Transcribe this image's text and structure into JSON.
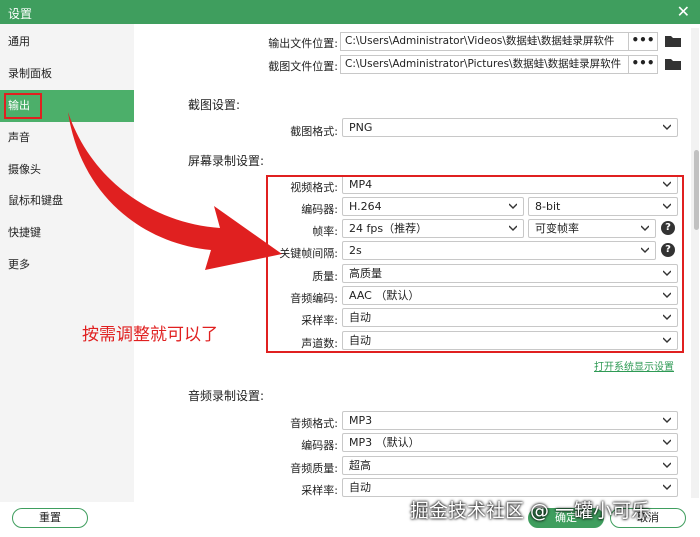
{
  "window": {
    "title": "设置"
  },
  "sidebar": {
    "items": [
      {
        "label": "通用"
      },
      {
        "label": "录制面板"
      },
      {
        "label": "输出"
      },
      {
        "label": "声音"
      },
      {
        "label": "摄像头"
      },
      {
        "label": "鼠标和键盘"
      },
      {
        "label": "快捷键"
      },
      {
        "label": "更多"
      }
    ],
    "active_index": 2
  },
  "output": {
    "output_location_label": "输出文件位置:",
    "output_location_value": "C:\\Users\\Administrator\\Videos\\数据蛙\\数据蛙录屏软件",
    "screenshot_location_label": "截图文件位置:",
    "screenshot_location_value": "C:\\Users\\Administrator\\Pictures\\数据蛙\\数据蛙录屏软件",
    "browse_label": "•••"
  },
  "screenshot_settings": {
    "heading": "截图设置:",
    "format_label": "截图格式:",
    "format_value": "PNG"
  },
  "screen_recording": {
    "heading": "屏幕录制设置:",
    "video_format_label": "视频格式:",
    "video_format_value": "MP4",
    "encoder_label": "编码器:",
    "encoder_value": "H.264",
    "bit_depth_value": "8-bit",
    "frame_rate_label": "帧率:",
    "frame_rate_value": "24 fps（推荐）",
    "frame_mode_value": "可变帧率",
    "keyframe_label": "关键帧间隔:",
    "keyframe_value": "2s",
    "quality_label": "质量:",
    "quality_value": "高质量",
    "audio_codec_label": "音频编码:",
    "audio_codec_value": "AAC （默认）",
    "sample_rate_label": "采样率:",
    "sample_rate_value": "自动",
    "channels_label": "声道数:",
    "channels_value": "自动",
    "display_settings_link": "打开系统显示设置"
  },
  "audio_recording": {
    "heading": "音频录制设置:",
    "audio_format_label": "音频格式:",
    "audio_format_value": "MP3",
    "encoder_label": "编码器:",
    "encoder_value": "MP3 （默认）",
    "quality_label": "音频质量:",
    "quality_value": "超高",
    "sample_rate_label": "采样率:",
    "sample_rate_value": "自动"
  },
  "footer": {
    "reset_label": "重置",
    "ok_label": "确定",
    "cancel_label": "取消"
  },
  "annotation": {
    "text": "按需调整就可以了"
  },
  "watermark": {
    "text": "掘金技术社区 @ 一罐小可乐"
  },
  "colors": {
    "accent": "#3f9e5e",
    "active_nav": "#4caf6a",
    "highlight": "#e02020",
    "link": "#2f9a55"
  },
  "icons": {
    "close": "close-icon",
    "folder": "folder-icon",
    "help": "help-icon",
    "chevron": "chevron-down-icon"
  }
}
